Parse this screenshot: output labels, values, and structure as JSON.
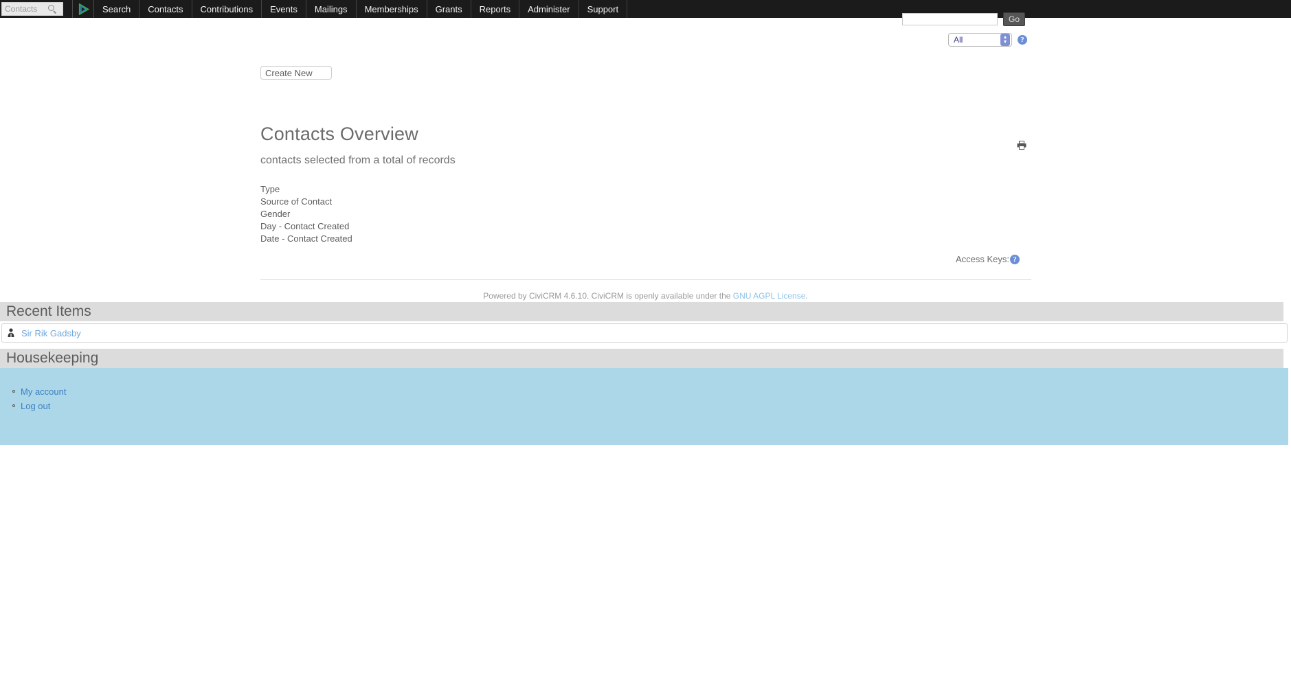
{
  "navbar": {
    "search_placeholder": "Contacts",
    "logo_name": "civicrm-logo",
    "items": [
      {
        "label": "Search"
      },
      {
        "label": "Contacts"
      },
      {
        "label": "Contributions"
      },
      {
        "label": "Events"
      },
      {
        "label": "Mailings"
      },
      {
        "label": "Memberships"
      },
      {
        "label": "Grants"
      },
      {
        "label": "Reports"
      },
      {
        "label": "Administer"
      },
      {
        "label": "Support"
      }
    ]
  },
  "quick_search": {
    "input_value": "",
    "go_label": "Go",
    "scope_selected": "All",
    "help_label": "?"
  },
  "toolbar": {
    "create_new_label": "Create New"
  },
  "report": {
    "title": "Contacts Overview",
    "subtitle": "contacts selected from a total of records",
    "fields": [
      "Type",
      "Source of Contact",
      "Gender",
      "Day - Contact Created",
      "Date - Contact Created"
    ],
    "print_icon": "print-icon",
    "access_keys_label": "Access Keys:",
    "access_keys_help": "?"
  },
  "footer": {
    "text_before": "Powered by CiviCRM 4.6.10. CiviCRM is openly available under the ",
    "link_label": "GNU AGPL License",
    "text_after": "."
  },
  "recent_items": {
    "title": "Recent Items",
    "items": [
      {
        "icon": "contact-icon",
        "label": "Sir Rik Gadsby"
      }
    ]
  },
  "housekeeping": {
    "title": "Housekeeping",
    "items": [
      {
        "label": "My account"
      },
      {
        "label": "Log out"
      }
    ]
  },
  "colors": {
    "navbar_bg": "#1b1b1b",
    "block_header_bg": "#dcdcdc",
    "housekeeping_bg": "#abd7e8",
    "link_blue": "#3d7fc1",
    "help_blue": "#6b8fd4"
  }
}
